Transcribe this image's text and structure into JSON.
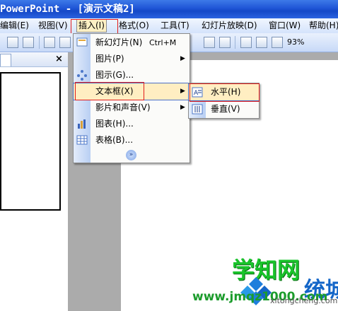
{
  "window": {
    "title": "PowerPoint - [演示文稿2]"
  },
  "menubar": {
    "items": [
      "编辑(E)",
      "视图(V)",
      "插入(I)",
      "格式(O)",
      "工具(T)",
      "幻灯片放映(D)",
      "窗口(W)",
      "帮助(H)"
    ],
    "active": "插入(I)"
  },
  "toolbar": {
    "zoom": "93%"
  },
  "left_pane": {
    "close": "×"
  },
  "insert_menu": {
    "items": [
      {
        "label": "新幻灯片(N)",
        "shortcut": "Ctrl+M",
        "icon": "new-slide-icon"
      },
      {
        "label": "图片(P)",
        "submenu": true,
        "icon": ""
      },
      {
        "label": "图示(G)...",
        "icon": "diagram-icon"
      },
      {
        "label": "文本框(X)",
        "submenu": true,
        "highlighted": true,
        "icon": ""
      },
      {
        "label": "影片和声音(V)",
        "submenu": true,
        "icon": ""
      },
      {
        "label": "图表(H)...",
        "icon": "chart-icon"
      },
      {
        "label": "表格(B)...",
        "icon": "table-icon"
      }
    ],
    "more": "»"
  },
  "textbox_submenu": {
    "items": [
      {
        "label": "水平(H)",
        "icon": "horizontal-textbox-icon",
        "highlighted": true
      },
      {
        "label": "垂直(V)",
        "icon": "vertical-textbox-icon"
      }
    ]
  },
  "watermark": {
    "title": "学知网",
    "side": "统城",
    "url": "www.jmqz1000.com",
    "sub": "xitongcheng.com"
  },
  "colors": {
    "highlight": "#ffeec2",
    "annotation": "#e11c1c",
    "titlebar": "#1f55d6"
  }
}
